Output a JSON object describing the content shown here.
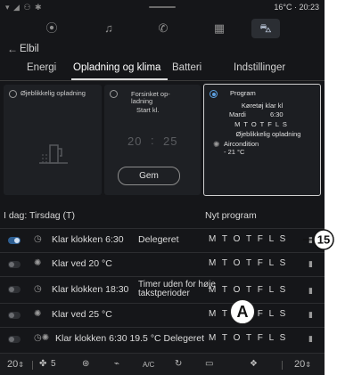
{
  "status_bar": {
    "left_icons": "▾ ◢ ⚇ ✱",
    "right": "16°C · 20:23"
  },
  "nav_icons": [
    "location-icon",
    "music-icon",
    "phone-icon",
    "apps-icon",
    "car-icon"
  ],
  "header": {
    "back": "←",
    "title": "Elbil"
  },
  "tabs": [
    "Energi",
    "Opladning og klima",
    "Batteri",
    "Indstillinger"
  ],
  "cards": {
    "immediate": {
      "label": "Øjeblikkelig opladning"
    },
    "delayed": {
      "label_line1": "Forsinket op-",
      "label_line2": "ladning",
      "start": "Start kl.",
      "time_h": "20",
      "time_sep": ":",
      "time_m": "25",
      "button": "Gem"
    },
    "program": {
      "label": "Program",
      "line1": "Køretøj klar kl",
      "line2_day": "Mardi",
      "line2_time": "6:30",
      "days": "M T O T F L S",
      "line4": "Øjeblikkelig opladning",
      "ac_line1": "Aircondition",
      "ac_line2": "- 21 °C"
    }
  },
  "list": {
    "today": "I dag: Tirsdag (T)",
    "new_program": "Nyt program",
    "rows": [
      {
        "text": "Klar klokken 6:30",
        "extra": "Delegeret",
        "days": "M T O T F L S",
        "on": true
      },
      {
        "text": "Klar ved 20 °C",
        "extra": "",
        "days": "M T O T F L S",
        "on": false
      },
      {
        "text": "Klar klokken 18:30",
        "extra_line1": "Timer uden for høje",
        "extra_line2": "takstperioder",
        "days": "M T O T F L S",
        "on": false
      },
      {
        "text": "Klar ved 25 °C",
        "extra": "",
        "days": "M T O T F L S",
        "on": false
      },
      {
        "text": "Klar klokken 6:30 19.5 °C Delegeret",
        "extra": "",
        "days": "M T O T F L S",
        "on": false
      }
    ]
  },
  "bottom_bar": {
    "temp_left": "20",
    "fan": "5",
    "ac": "A/C",
    "temp_right": "20"
  },
  "callouts": {
    "number": "15",
    "letter": "A"
  }
}
